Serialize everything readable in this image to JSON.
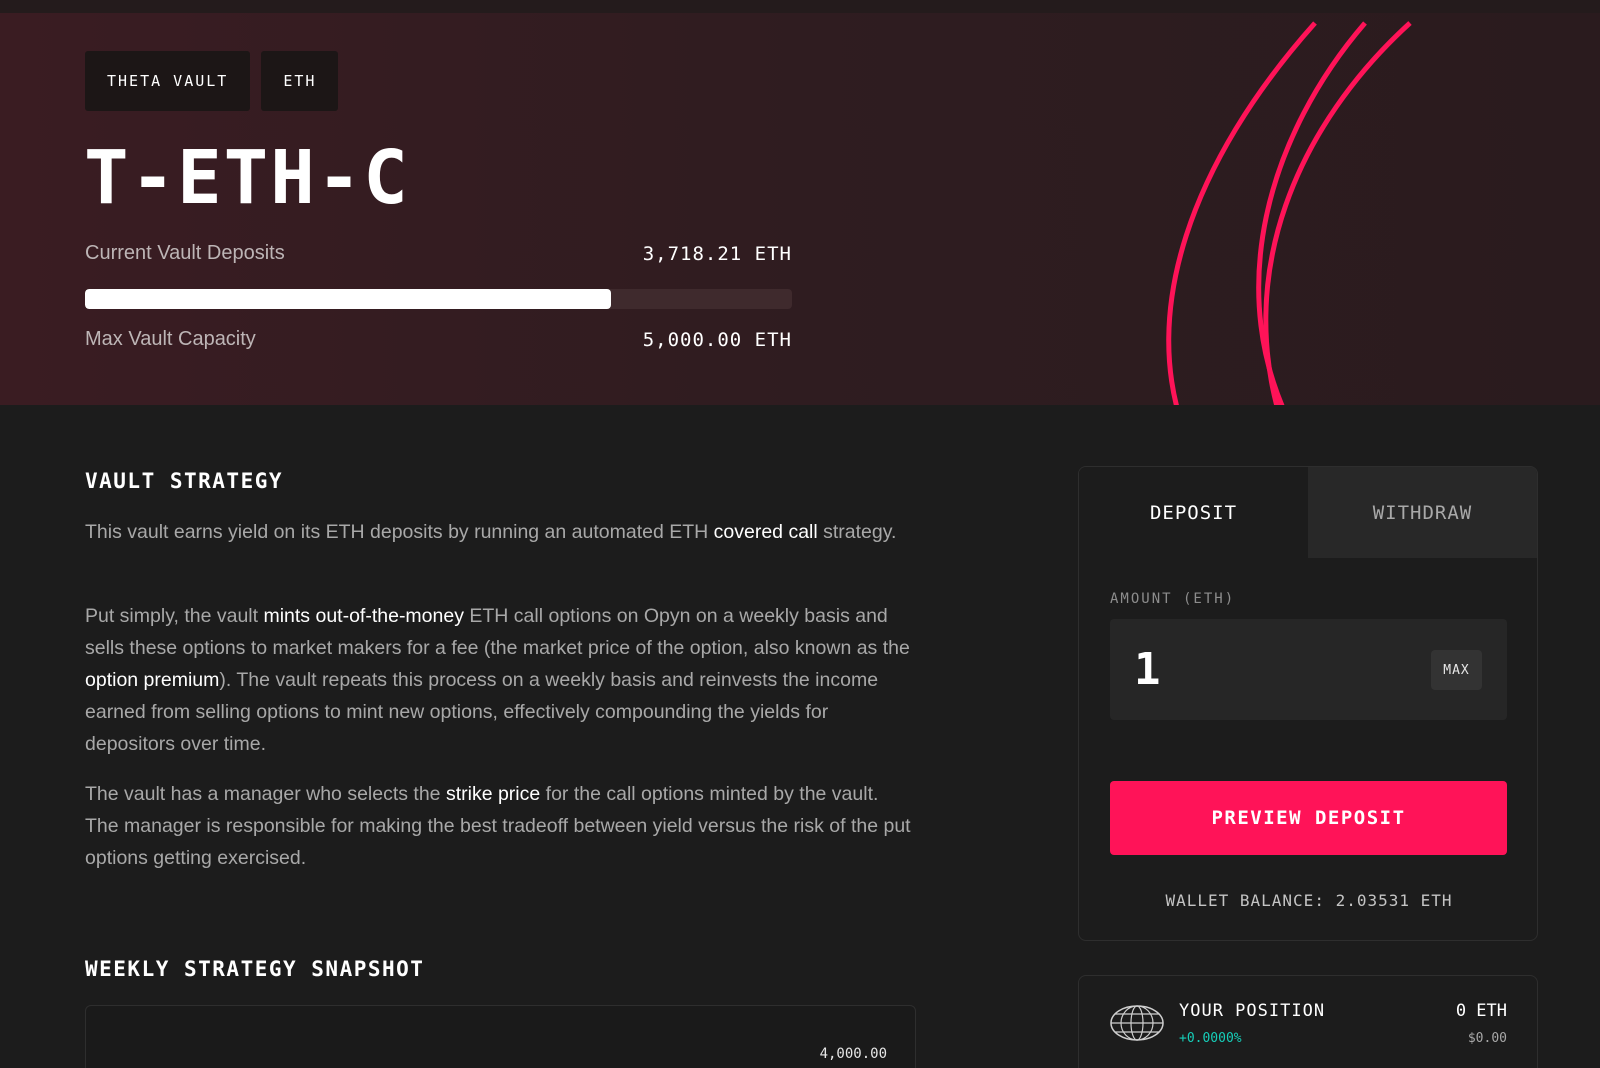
{
  "hero": {
    "tags": [
      "THETA VAULT",
      "ETH"
    ],
    "title": "T-ETH-C",
    "current_deposits_label": "Current Vault Deposits",
    "current_deposits_value": "3,718.21 ETH",
    "max_capacity_label": "Max Vault Capacity",
    "max_capacity_value": "5,000.00 ETH",
    "progress_fraction": 0.7436,
    "accent_color": "#ff1358"
  },
  "strategy": {
    "title": "VAULT STRATEGY",
    "p1": {
      "t1": "This vault earns yield on its ETH deposits by running an automated ETH ",
      "h1": "covered call",
      "t2": " strategy."
    },
    "p2": {
      "t1": "Put simply, the vault ",
      "h1": "mints out-of-the-money",
      "t2": " ETH call options on Opyn on a weekly basis and sells these options to market makers for a fee (the market price of the option, also known as the ",
      "h2": "option premium",
      "t3": "). The vault repeats this process on a weekly basis and reinvests the income earned from selling options to mint new options, effectively compounding the yields for depositors over time."
    },
    "p3": {
      "t1": "The vault has a manager who selects the ",
      "h1": "strike price",
      "t2": " for the call options minted by the vault. The manager is responsible for making the best tradeoff between yield versus the risk of the put options getting exercised."
    }
  },
  "snapshot": {
    "title": "WEEKLY STRATEGY SNAPSHOT",
    "value_label": "4,000.00"
  },
  "deposit_panel": {
    "tab_deposit": "DEPOSIT",
    "tab_withdraw": "WITHDRAW",
    "amount_label": "AMOUNT (ETH)",
    "amount_value": "1",
    "max_label": "MAX",
    "preview_label": "PREVIEW DEPOSIT",
    "wallet_balance": "WALLET BALANCE: 2.03531 ETH"
  },
  "position": {
    "title": "YOUR POSITION",
    "change": "+0.0000%",
    "eth": "0 ETH",
    "usd": "$0.00"
  }
}
